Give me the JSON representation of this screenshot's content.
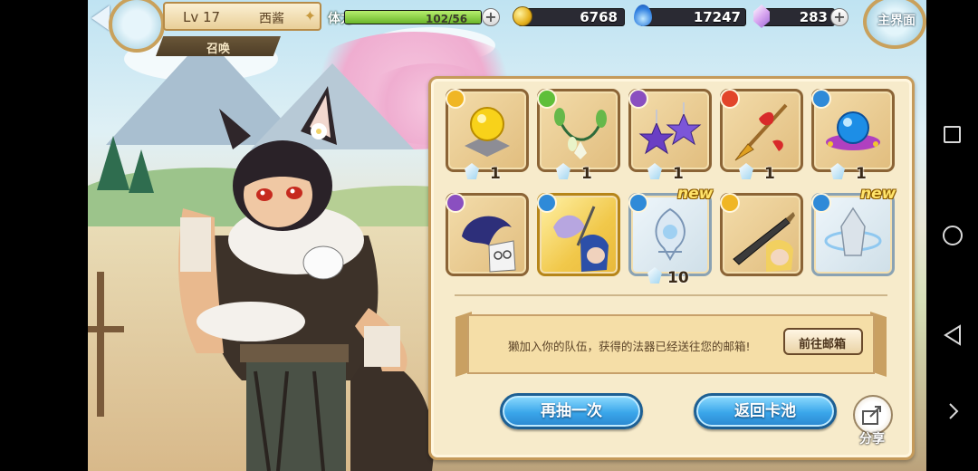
{
  "hud": {
    "back_label": "返回",
    "level_label": "Lv 17",
    "player_name": "西酱",
    "mode_label": "召唤",
    "stamina_label": "体力",
    "stamina_text": "102/56",
    "gold": "6768",
    "blue_gem": "17247",
    "crystal": "283",
    "main_menu_label": "主界面"
  },
  "results": {
    "row1": [
      {
        "name": "golden-orb-relic",
        "count": "1",
        "frame": "bronze",
        "element": "light"
      },
      {
        "name": "leaf-necklace",
        "count": "1",
        "frame": "bronze",
        "element": "wind"
      },
      {
        "name": "purple-star-earrings",
        "count": "1",
        "frame": "bronze",
        "element": "dark"
      },
      {
        "name": "red-ribbon-spear",
        "count": "1",
        "frame": "bronze",
        "element": "fire"
      },
      {
        "name": "blue-orb-crown",
        "count": "1",
        "frame": "bronze",
        "element": "water"
      }
    ],
    "row2": [
      {
        "name": "dark-haired-character",
        "count": "",
        "frame": "bronze",
        "element": "dark",
        "new": ""
      },
      {
        "name": "blue-haired-character",
        "count": "",
        "frame": "gold",
        "element": "water",
        "new": ""
      },
      {
        "name": "silver-crest-relic",
        "count": "10",
        "frame": "silver",
        "element": "water",
        "new": "new"
      },
      {
        "name": "dagger-blonde-character",
        "count": "",
        "frame": "bronze",
        "element": "light",
        "new": ""
      },
      {
        "name": "crystal-ring-relic",
        "count": "",
        "frame": "silver",
        "element": "water",
        "new": "new"
      }
    ]
  },
  "message": {
    "text": "獭加入你的队伍，获得的法器已经送往您的邮箱!",
    "mailbox_button": "前往邮箱"
  },
  "actions": {
    "draw_again": "再抽一次",
    "back_to_pool": "返回卡池",
    "share": "分享"
  },
  "colors": {
    "accent_blue": "#3aa6ea",
    "panel_cream": "#f7ebcb",
    "stamina_green": "#7bc43a",
    "new_yellow": "#ffe36a"
  }
}
